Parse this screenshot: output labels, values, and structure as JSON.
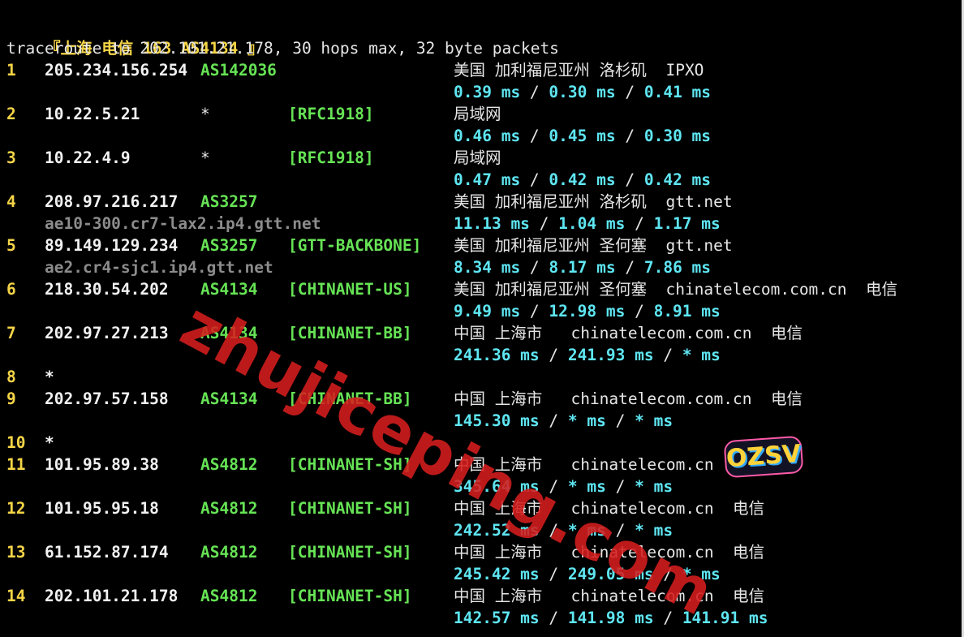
{
  "header": {
    "bracket_open": "『",
    "location": "上海 电信",
    "asn_label": "163 AS4134",
    "bracket_close": "』"
  },
  "command": "traceroute to 202.101.21.178, 30 hops max, 32 byte packets",
  "hops": [
    {
      "num": "1",
      "ip": "205.234.156.254",
      "asn": "AS142036",
      "net": "",
      "geo": "美国 加利福尼亚州 洛杉矶  IPXO",
      "rdns": "",
      "rtt": [
        "0.39 ms",
        "0.30 ms",
        "0.41 ms"
      ]
    },
    {
      "num": "2",
      "ip": "10.22.5.21",
      "asn": "*",
      "net": "[RFC1918]",
      "geo": "局域网",
      "rdns": "",
      "rtt": [
        "0.46 ms",
        "0.45 ms",
        "0.30 ms"
      ]
    },
    {
      "num": "3",
      "ip": "10.22.4.9",
      "asn": "*",
      "net": "[RFC1918]",
      "geo": "局域网",
      "rdns": "",
      "rtt": [
        "0.47 ms",
        "0.42 ms",
        "0.42 ms"
      ]
    },
    {
      "num": "4",
      "ip": "208.97.216.217",
      "asn": "AS3257",
      "net": "",
      "geo": "美国 加利福尼亚州 洛杉矶  gtt.net",
      "rdns": "ae10-300.cr7-lax2.ip4.gtt.net",
      "rtt": [
        "11.13 ms",
        "1.04 ms",
        "1.17 ms"
      ]
    },
    {
      "num": "5",
      "ip": "89.149.129.234",
      "asn": "AS3257",
      "net": "[GTT-BACKBONE]",
      "geo": "美国 加利福尼亚州 圣何塞  gtt.net",
      "rdns": "ae2.cr4-sjc1.ip4.gtt.net",
      "rtt": [
        "8.34 ms",
        "8.17 ms",
        "7.86 ms"
      ]
    },
    {
      "num": "6",
      "ip": "218.30.54.202",
      "asn": "AS4134",
      "net": "[CHINANET-US]",
      "geo": "美国 加利福尼亚州 圣何塞  chinatelecom.com.cn  电信",
      "rdns": "",
      "rtt": [
        "9.49 ms",
        "12.98 ms",
        "8.91 ms"
      ]
    },
    {
      "num": "7",
      "ip": "202.97.27.213",
      "asn": "AS4134",
      "net": "[CHINANET-BB]",
      "geo": "中国 上海市   chinatelecom.com.cn  电信",
      "rdns": "",
      "rtt": [
        "241.36 ms",
        "241.93 ms",
        "* ms"
      ]
    },
    {
      "num": "8",
      "ip": "*",
      "asn": "",
      "net": "",
      "geo": "",
      "rdns": "",
      "rtt": []
    },
    {
      "num": "9",
      "ip": "202.97.57.158",
      "asn": "AS4134",
      "net": "[CHINANET-BB]",
      "geo": "中国 上海市   chinatelecom.com.cn  电信",
      "rdns": "",
      "rtt": [
        "145.30 ms",
        "* ms",
        "* ms"
      ]
    },
    {
      "num": "10",
      "ip": "*",
      "asn": "",
      "net": "",
      "geo": "",
      "rdns": "",
      "rtt": []
    },
    {
      "num": "11",
      "ip": "101.95.89.38",
      "asn": "AS4812",
      "net": "[CHINANET-SH]",
      "geo": "中国 上海市   chinatelecom.cn",
      "rdns": "",
      "rtt": [
        "345.64 ms",
        "* ms",
        "* ms"
      ]
    },
    {
      "num": "12",
      "ip": "101.95.95.18",
      "asn": "AS4812",
      "net": "[CHINANET-SH]",
      "geo": "中国 上海市   chinatelecom.cn  电信",
      "rdns": "",
      "rtt": [
        "242.52 ms",
        "* ms",
        "* ms"
      ]
    },
    {
      "num": "13",
      "ip": "61.152.87.174",
      "asn": "AS4812",
      "net": "[CHINANET-SH]",
      "geo": "中国 上海市   chinatelecom.cn  电信",
      "rdns": "",
      "rtt": [
        "245.42 ms",
        "249.05 ms",
        "* ms"
      ]
    },
    {
      "num": "14",
      "ip": "202.101.21.178",
      "asn": "AS4812",
      "net": "[CHINANET-SH]",
      "geo": "中国 上海市   chinatelecom.cn  电信",
      "rdns": "",
      "rtt": [
        "142.57 ms",
        "141.98 ms",
        "141.91 ms"
      ]
    }
  ],
  "rtt_separator": " / ",
  "watermark": "zhujiceping.com",
  "badge": "OZSV",
  "colors": {
    "background": "#000000",
    "hop_number": "#f5d547",
    "ip": "#f2f2f2",
    "asn": "#66e355",
    "rtt": "#5ee6f2",
    "rdns": "#8c8c8c",
    "watermark": "#d61e1e"
  }
}
